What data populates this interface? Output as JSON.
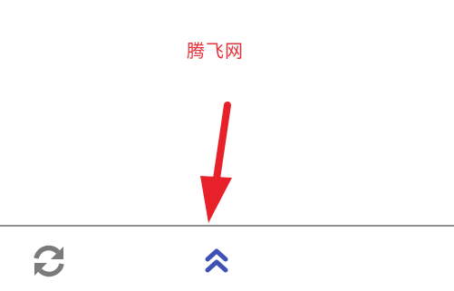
{
  "watermark": {
    "text": "腾飞网",
    "color": "#e8303a"
  },
  "annotation": {
    "arrow_color": "#e8202a"
  },
  "bottom_bar": {
    "divider_color": "#8e8e8e",
    "refresh_icon": "refresh-icon",
    "refresh_icon_color": "#7b7b7b",
    "expand_icon": "double-chevron-up-icon",
    "expand_icon_color": "#3f51b5"
  }
}
